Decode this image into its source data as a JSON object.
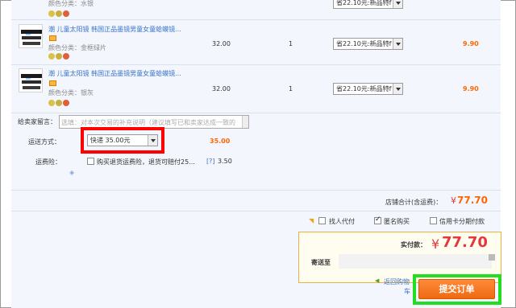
{
  "items": [
    {
      "category": "颜色分类：水银",
      "coupon": "省22.10元:新品特f",
      "title": "",
      "price": "",
      "qty": "",
      "subtotal": ""
    },
    {
      "title": "潮 儿童太阳镜 韩国正品墨镜男童女童蛤蟆镜...",
      "category": "颜色分类：金框绿片",
      "price": "32.00",
      "qty": "1",
      "coupon": "省22.10元:新品特f",
      "subtotal": "9.90"
    },
    {
      "title": "潮 儿童太阳镜 韩国正品墨镜男童女童蛤蟆镜...",
      "category": "颜色分类：银灰",
      "price": "32.00",
      "qty": "1",
      "coupon": "省22.10元:新品特f",
      "subtotal": "9.90"
    }
  ],
  "message": {
    "label": "给卖家留言：",
    "placeholder": "选填：对本次交易的补充说明（建议填写已和卖家达成一致的"
  },
  "shipping": {
    "label": "运送方式：",
    "selected": "快递 35.00元",
    "fee": "35.00"
  },
  "insurance": {
    "label": "运费险：",
    "checkbox_label": "购买退货运费险，退货可赔付25...",
    "help": "[?]",
    "fee": "3.50"
  },
  "store_total": {
    "label": "店铺合计(含运费)：",
    "currency": "¥",
    "amount": "77.70"
  },
  "options": {
    "proxy_pay": "找人代付",
    "anonymous": "匿名购买",
    "credit_installment": "信用卡分期付款"
  },
  "summary": {
    "actual_label": "实付款：",
    "currency": "¥",
    "amount": "77.70",
    "ship_to_label": "寄送至",
    "back_link": "返回购物",
    "back_link_2": "车"
  },
  "submit_label": "提交订单",
  "colors": {
    "accent_orange": "#ff6600",
    "price_red": "#e4393c",
    "highlight_red": "#ff0000",
    "highlight_green": "#22dd22",
    "submit_button": "#f6741c"
  }
}
